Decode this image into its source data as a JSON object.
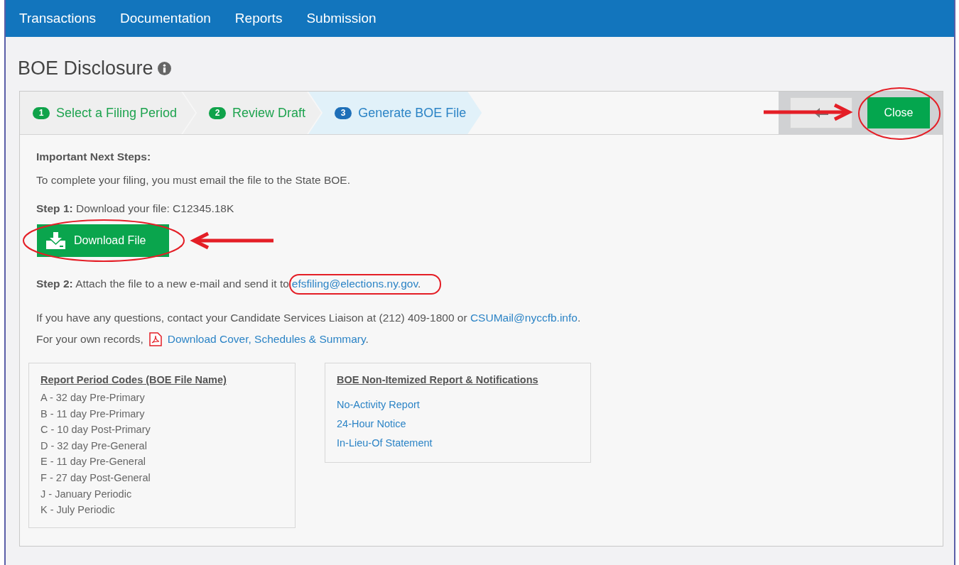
{
  "nav": {
    "items": [
      "Transactions",
      "Documentation",
      "Reports",
      "Submission"
    ]
  },
  "title": "BOE Disclosure",
  "steps": [
    {
      "number": "1",
      "label": "Select a Filing Period",
      "selected": false
    },
    {
      "number": "2",
      "label": "Review Draft",
      "selected": false
    },
    {
      "number": "3",
      "label": "Generate BOE File",
      "selected": true
    }
  ],
  "wizard_buttons": {
    "close": "Close"
  },
  "content": {
    "heading": "Important Next Steps:",
    "intro": "To complete your filing, you must email the file to the State BOE.",
    "step1": "**Step 1:** Download your file: C12345.18K",
    "download_button": "Download File",
    "step2": {
      "text": "**Step 2:** Attach the file to a new e-mail and send it to",
      "link": "efsfiling@elections.ny.gov",
      "end": "."
    },
    "questions": {
      "text": "If you have any questions, contact your Candidate Services Liaison at (212) 409-1800 or",
      "link": "CSUMail@nyccfb.info",
      "end": "."
    },
    "records": {
      "text": "For your own records,",
      "link": "Download Cover, Schedules & Summary",
      "end": "."
    }
  },
  "codes_box": {
    "title": "Report Period Codes (BOE File Name)",
    "items": [
      "A - 32 day Pre-Primary",
      "B - 11 day Pre-Primary",
      "C - 10 day Post-Primary",
      "D - 32 day Pre-General",
      "E - 11 day Pre-General",
      "F - 27 day Post-General",
      "J - January Periodic",
      "K - July Periodic"
    ]
  },
  "notices_box": {
    "title": "BOE Non-Itemized Report & Notifications",
    "links": [
      "No-Activity Report",
      "24-Hour Notice",
      "In-Lieu-Of Statement"
    ]
  }
}
